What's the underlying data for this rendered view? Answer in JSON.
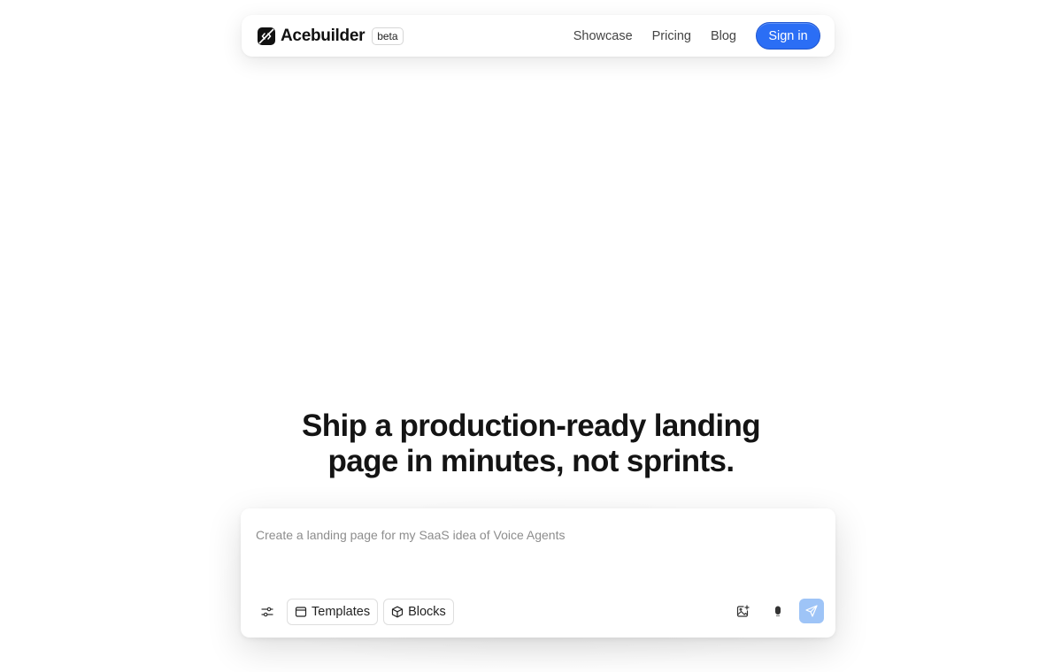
{
  "nav": {
    "brand": "Acebuilder",
    "badge": "beta",
    "links": [
      "Showcase",
      "Pricing",
      "Blog"
    ],
    "signin_label": "Sign in",
    "accent_color": "#2b6ef5"
  },
  "hero": {
    "title_line1": "Ship a production-ready landing",
    "title_line2": "page in minutes, not sprints."
  },
  "prompt": {
    "placeholder": "Create a landing page for my SaaS idea of Voice Agents",
    "value": "",
    "templates_label": "Templates",
    "blocks_label": "Blocks",
    "icons": {
      "settings": "sliders-icon",
      "templates": "window-icon",
      "blocks": "cube-icon",
      "image": "image-plus-icon",
      "voice": "microphone-icon",
      "send": "send-icon"
    },
    "send_color": "#9ec4f7"
  }
}
